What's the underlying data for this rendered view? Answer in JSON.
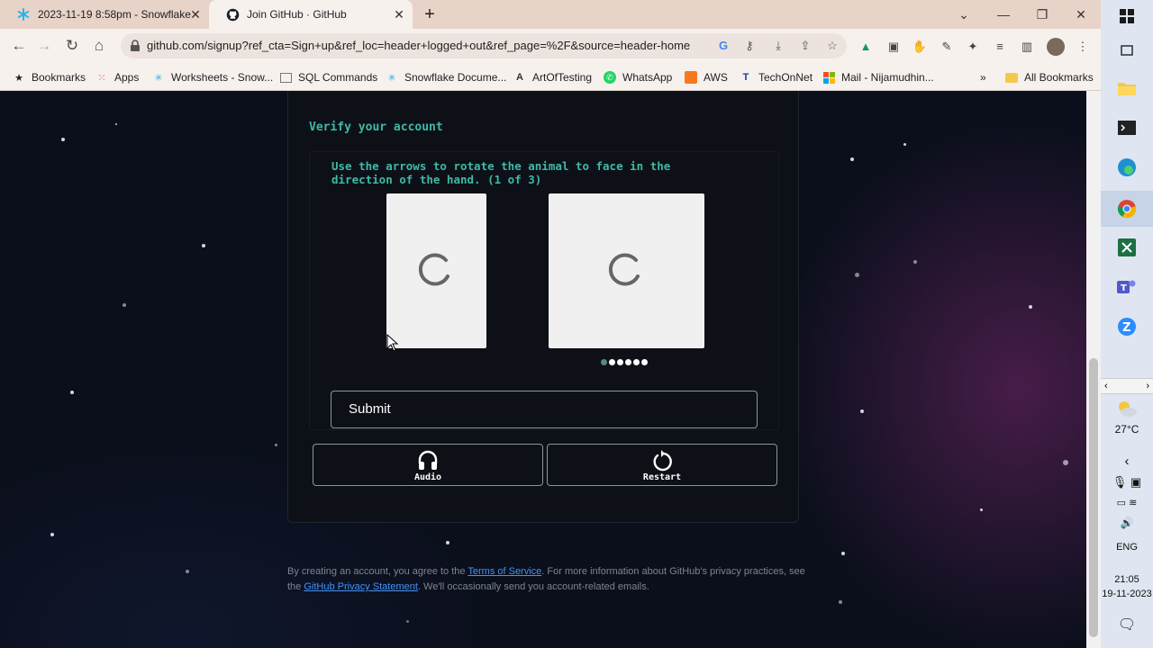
{
  "browser": {
    "tabs": [
      {
        "title": "2023-11-19 8:58pm - Snowflake",
        "icon": "snowflake-icon"
      },
      {
        "title": "Join GitHub · GitHub",
        "icon": "github-icon",
        "active": true
      }
    ],
    "url": "github.com/signup?ref_cta=Sign+up&ref_loc=header+logged+out&ref_page=%2F&source=header-home",
    "bookmarks": [
      {
        "label": "Bookmarks",
        "icon": "star-icon"
      },
      {
        "label": "Apps",
        "icon": "apps-grid-icon"
      },
      {
        "label": "Worksheets - Snow...",
        "icon": "snowflake-icon"
      },
      {
        "label": "SQL Commands",
        "icon": "page-icon"
      },
      {
        "label": "Snowflake Docume...",
        "icon": "snowflake-icon"
      },
      {
        "label": "ArtOfTesting",
        "icon": "a-icon"
      },
      {
        "label": "WhatsApp",
        "icon": "whatsapp-icon"
      },
      {
        "label": "AWS",
        "icon": "aws-icon"
      },
      {
        "label": "TechOnNet",
        "icon": "t-icon"
      },
      {
        "label": "Mail - Nijamudhin...",
        "icon": "microsoft-icon"
      }
    ],
    "all_bookmarks": "All Bookmarks",
    "more_bookmarks": "»"
  },
  "captcha": {
    "title": "Verify your account",
    "instruction": "Use the arrows to rotate the animal to face in the direction of the hand. (1 of 3)",
    "progress": {
      "current": 1,
      "total": 6
    },
    "submit_label": "Submit",
    "audio_label": "Audio",
    "restart_label": "Restart"
  },
  "legal": {
    "prefix": "By creating an account, you agree to the ",
    "terms_link": "Terms of Service",
    "middle": ". For more information about GitHub's privacy practices, see the ",
    "privacy_link": "GitHub Privacy Statement",
    "suffix": ". We'll occasionally send you account-related emails."
  },
  "taskbar": {
    "weather": "27°C",
    "language": "ENG",
    "time": "21:05",
    "date": "19-11-2023"
  }
}
